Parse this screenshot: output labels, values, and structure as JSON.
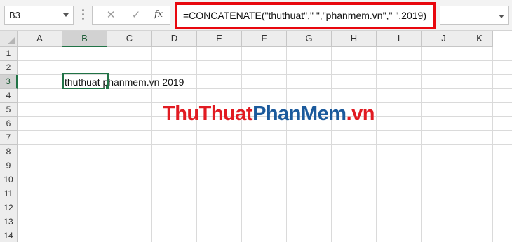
{
  "name_box": {
    "value": "B3"
  },
  "formula_bar": {
    "cancel_icon": "✕",
    "enter_icon": "✓",
    "fx_label": "fx",
    "formula": "=CONCATENATE(\"thuthuat\",\" \",\"phanmem.vn\",\" \",2019)"
  },
  "columns": [
    "A",
    "B",
    "C",
    "D",
    "E",
    "F",
    "G",
    "H",
    "I",
    "J",
    "K"
  ],
  "rows": [
    "1",
    "2",
    "3",
    "4",
    "5",
    "6",
    "7",
    "8",
    "9",
    "10",
    "11",
    "12",
    "13",
    "14"
  ],
  "selected_cell": {
    "column": "B",
    "row": "3"
  },
  "cell_B3": {
    "display": "thuthuat phanmem.vn 2019"
  },
  "watermark": {
    "part1": "ThuThuat",
    "part2": "PhanMem",
    "part3": ".vn"
  },
  "colors": {
    "accent_green": "#217346",
    "highlight_red": "#e8070e",
    "wm_red": "#e11b22",
    "wm_blue": "#1b5a9c"
  }
}
